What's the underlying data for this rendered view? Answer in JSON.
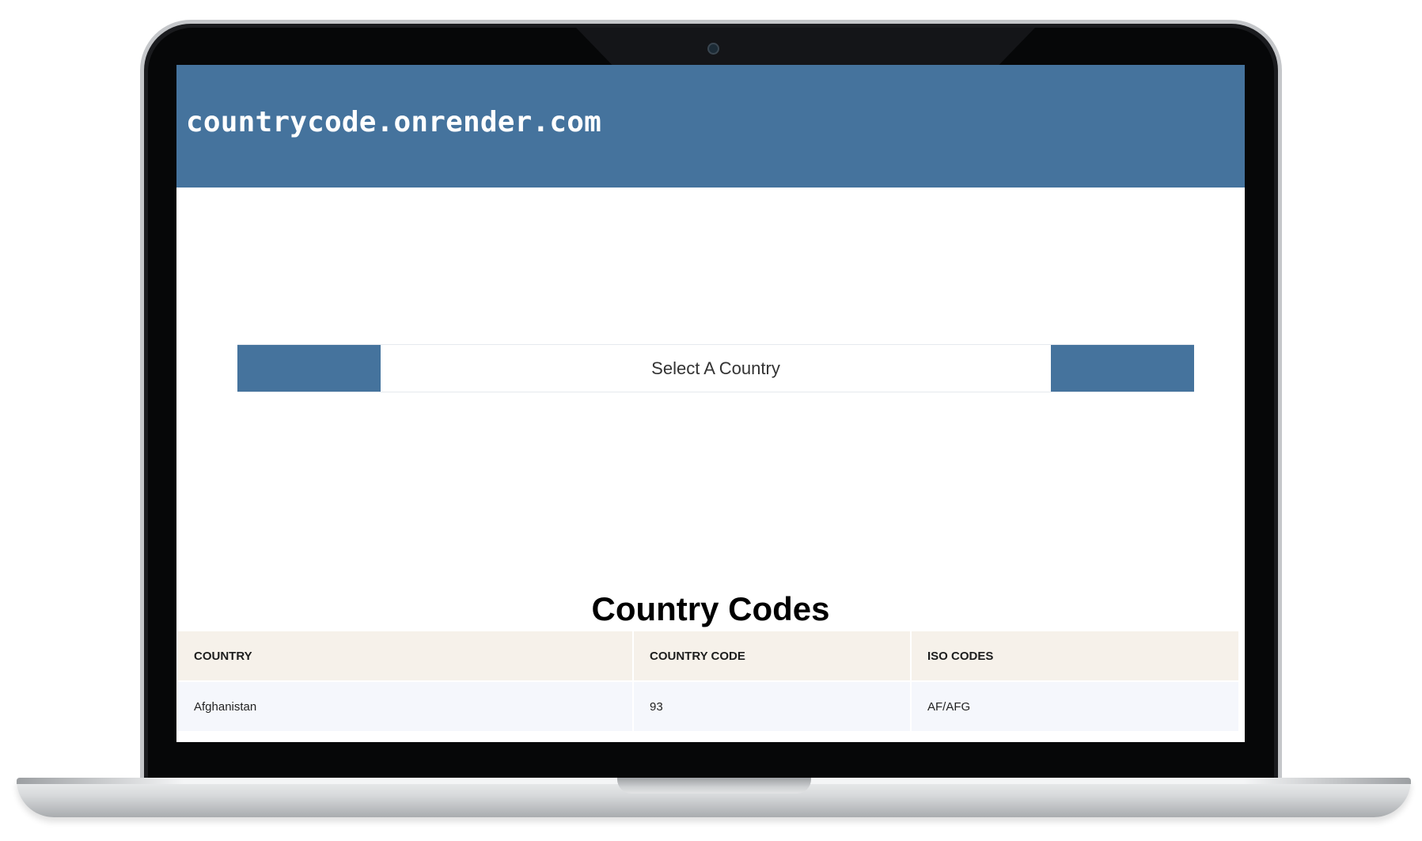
{
  "site": {
    "title": "countrycode.onrender.com"
  },
  "selector": {
    "label": "Select A Country"
  },
  "section": {
    "heading": "Country Codes"
  },
  "table": {
    "headers": [
      "COUNTRY",
      "COUNTRY CODE",
      "ISO CODES"
    ],
    "rows": [
      [
        "Afghanistan",
        "93",
        "AF/AFG"
      ]
    ]
  },
  "colors": {
    "primary": "#45739d",
    "header_row_bg": "#f6f1ea",
    "row_bg": "#f5f7fc"
  }
}
